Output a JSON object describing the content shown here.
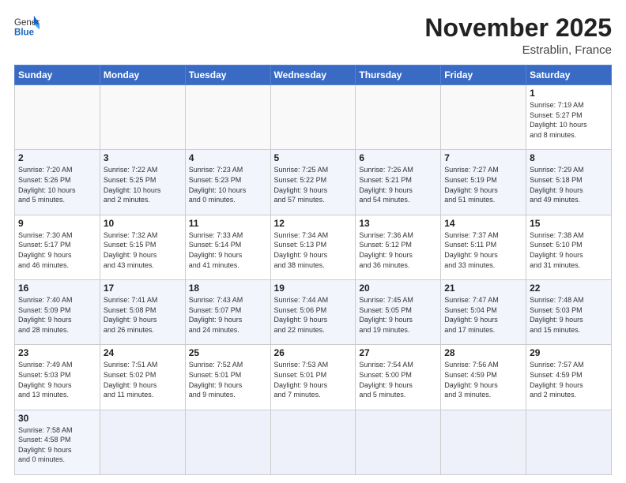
{
  "header": {
    "logo_general": "General",
    "logo_blue": "Blue",
    "month_title": "November 2025",
    "location": "Estrablin, France"
  },
  "days_of_week": [
    "Sunday",
    "Monday",
    "Tuesday",
    "Wednesday",
    "Thursday",
    "Friday",
    "Saturday"
  ],
  "weeks": [
    [
      {
        "day": "",
        "info": ""
      },
      {
        "day": "",
        "info": ""
      },
      {
        "day": "",
        "info": ""
      },
      {
        "day": "",
        "info": ""
      },
      {
        "day": "",
        "info": ""
      },
      {
        "day": "",
        "info": ""
      },
      {
        "day": "1",
        "info": "Sunrise: 7:19 AM\nSunset: 5:27 PM\nDaylight: 10 hours\nand 8 minutes."
      }
    ],
    [
      {
        "day": "2",
        "info": "Sunrise: 7:20 AM\nSunset: 5:26 PM\nDaylight: 10 hours\nand 5 minutes."
      },
      {
        "day": "3",
        "info": "Sunrise: 7:22 AM\nSunset: 5:25 PM\nDaylight: 10 hours\nand 2 minutes."
      },
      {
        "day": "4",
        "info": "Sunrise: 7:23 AM\nSunset: 5:23 PM\nDaylight: 10 hours\nand 0 minutes."
      },
      {
        "day": "5",
        "info": "Sunrise: 7:25 AM\nSunset: 5:22 PM\nDaylight: 9 hours\nand 57 minutes."
      },
      {
        "day": "6",
        "info": "Sunrise: 7:26 AM\nSunset: 5:21 PM\nDaylight: 9 hours\nand 54 minutes."
      },
      {
        "day": "7",
        "info": "Sunrise: 7:27 AM\nSunset: 5:19 PM\nDaylight: 9 hours\nand 51 minutes."
      },
      {
        "day": "8",
        "info": "Sunrise: 7:29 AM\nSunset: 5:18 PM\nDaylight: 9 hours\nand 49 minutes."
      }
    ],
    [
      {
        "day": "9",
        "info": "Sunrise: 7:30 AM\nSunset: 5:17 PM\nDaylight: 9 hours\nand 46 minutes."
      },
      {
        "day": "10",
        "info": "Sunrise: 7:32 AM\nSunset: 5:15 PM\nDaylight: 9 hours\nand 43 minutes."
      },
      {
        "day": "11",
        "info": "Sunrise: 7:33 AM\nSunset: 5:14 PM\nDaylight: 9 hours\nand 41 minutes."
      },
      {
        "day": "12",
        "info": "Sunrise: 7:34 AM\nSunset: 5:13 PM\nDaylight: 9 hours\nand 38 minutes."
      },
      {
        "day": "13",
        "info": "Sunrise: 7:36 AM\nSunset: 5:12 PM\nDaylight: 9 hours\nand 36 minutes."
      },
      {
        "day": "14",
        "info": "Sunrise: 7:37 AM\nSunset: 5:11 PM\nDaylight: 9 hours\nand 33 minutes."
      },
      {
        "day": "15",
        "info": "Sunrise: 7:38 AM\nSunset: 5:10 PM\nDaylight: 9 hours\nand 31 minutes."
      }
    ],
    [
      {
        "day": "16",
        "info": "Sunrise: 7:40 AM\nSunset: 5:09 PM\nDaylight: 9 hours\nand 28 minutes."
      },
      {
        "day": "17",
        "info": "Sunrise: 7:41 AM\nSunset: 5:08 PM\nDaylight: 9 hours\nand 26 minutes."
      },
      {
        "day": "18",
        "info": "Sunrise: 7:43 AM\nSunset: 5:07 PM\nDaylight: 9 hours\nand 24 minutes."
      },
      {
        "day": "19",
        "info": "Sunrise: 7:44 AM\nSunset: 5:06 PM\nDaylight: 9 hours\nand 22 minutes."
      },
      {
        "day": "20",
        "info": "Sunrise: 7:45 AM\nSunset: 5:05 PM\nDaylight: 9 hours\nand 19 minutes."
      },
      {
        "day": "21",
        "info": "Sunrise: 7:47 AM\nSunset: 5:04 PM\nDaylight: 9 hours\nand 17 minutes."
      },
      {
        "day": "22",
        "info": "Sunrise: 7:48 AM\nSunset: 5:03 PM\nDaylight: 9 hours\nand 15 minutes."
      }
    ],
    [
      {
        "day": "23",
        "info": "Sunrise: 7:49 AM\nSunset: 5:03 PM\nDaylight: 9 hours\nand 13 minutes."
      },
      {
        "day": "24",
        "info": "Sunrise: 7:51 AM\nSunset: 5:02 PM\nDaylight: 9 hours\nand 11 minutes."
      },
      {
        "day": "25",
        "info": "Sunrise: 7:52 AM\nSunset: 5:01 PM\nDaylight: 9 hours\nand 9 minutes."
      },
      {
        "day": "26",
        "info": "Sunrise: 7:53 AM\nSunset: 5:01 PM\nDaylight: 9 hours\nand 7 minutes."
      },
      {
        "day": "27",
        "info": "Sunrise: 7:54 AM\nSunset: 5:00 PM\nDaylight: 9 hours\nand 5 minutes."
      },
      {
        "day": "28",
        "info": "Sunrise: 7:56 AM\nSunset: 4:59 PM\nDaylight: 9 hours\nand 3 minutes."
      },
      {
        "day": "29",
        "info": "Sunrise: 7:57 AM\nSunset: 4:59 PM\nDaylight: 9 hours\nand 2 minutes."
      }
    ],
    [
      {
        "day": "30",
        "info": "Sunrise: 7:58 AM\nSunset: 4:58 PM\nDaylight: 9 hours\nand 0 minutes."
      },
      {
        "day": "",
        "info": ""
      },
      {
        "day": "",
        "info": ""
      },
      {
        "day": "",
        "info": ""
      },
      {
        "day": "",
        "info": ""
      },
      {
        "day": "",
        "info": ""
      },
      {
        "day": "",
        "info": ""
      }
    ]
  ]
}
